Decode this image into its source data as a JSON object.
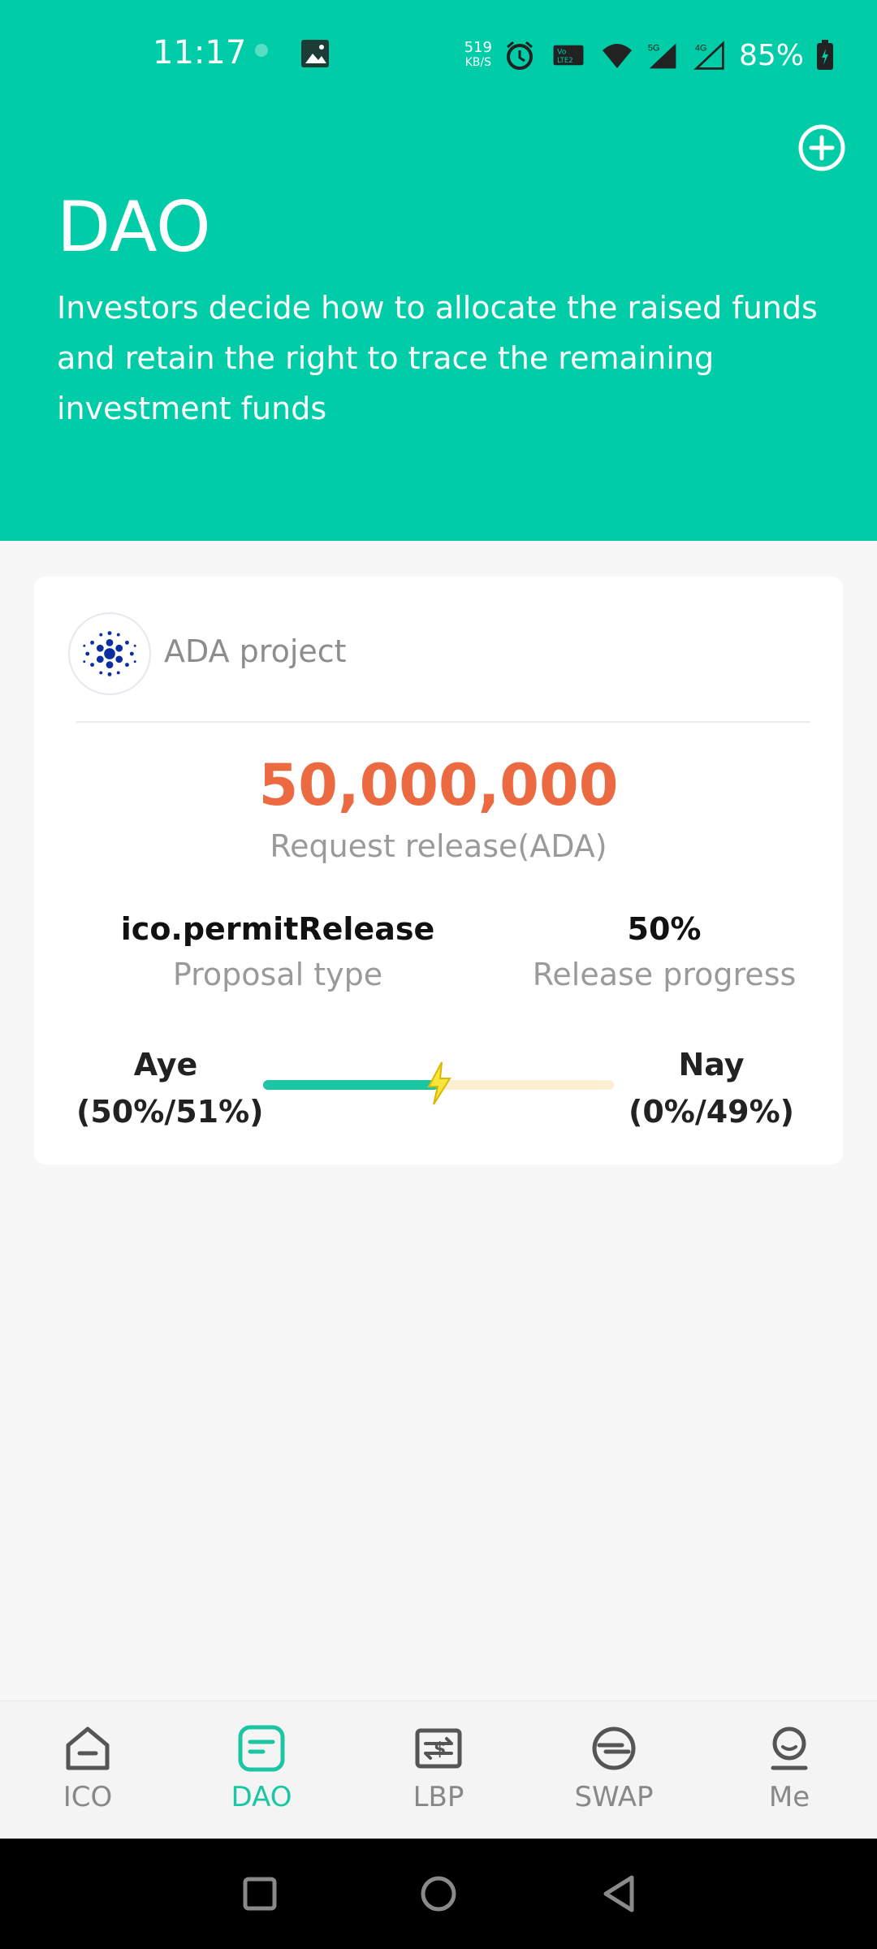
{
  "status_bar": {
    "time": "11:17",
    "net_speed_value": "519",
    "net_speed_unit": "KB/S",
    "network_5g": "5G",
    "network_4g": "4G",
    "battery": "85%"
  },
  "header": {
    "title": "DAO",
    "subtitle": "Investors decide how to allocate the raised funds and retain the right to trace the remaining investment funds",
    "background_color": "#00cda8"
  },
  "proposal_card": {
    "project_name": "ADA project",
    "amount": "50,000,000",
    "amount_label": "Request release(ADA)",
    "amount_color": "#ec6a42",
    "proposal_type_value": "ico.permitRelease",
    "proposal_type_label": "Proposal type",
    "release_progress_value": "50%",
    "release_progress_label": "Release progress",
    "aye_label": "Aye",
    "aye_value": "(50%/51%)",
    "nay_label": "Nay",
    "nay_value": "(0%/49%)",
    "aye_fraction": 0.5,
    "accent_color": "#1dc6a2"
  },
  "bottom_nav": {
    "items": [
      {
        "label": "ICO",
        "icon": "home-icon",
        "active": false
      },
      {
        "label": "DAO",
        "icon": "document-icon",
        "active": true
      },
      {
        "label": "LBP",
        "icon": "exchange-icon",
        "active": false
      },
      {
        "label": "SWAP",
        "icon": "swap-icon",
        "active": false
      },
      {
        "label": "Me",
        "icon": "user-icon",
        "active": false
      }
    ]
  },
  "system_nav": {
    "buttons": [
      "recents-icon",
      "home-circle-icon",
      "back-icon"
    ]
  }
}
